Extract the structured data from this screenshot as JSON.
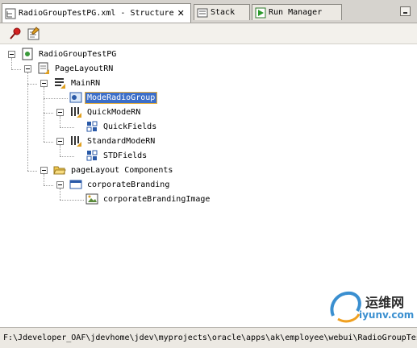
{
  "tabs": [
    {
      "label": "RadioGroupTestPG.xml - Structure",
      "icon": "structure-icon",
      "active": true
    },
    {
      "label": "Stack",
      "icon": "stack-icon",
      "active": false
    },
    {
      "label": "Run Manager",
      "icon": "run-manager-icon",
      "active": false
    }
  ],
  "toolbar": {
    "pin_icon": "pin-icon",
    "properties_icon": "properties-icon"
  },
  "tree": {
    "root": "RadioGroupTestPG",
    "page_layout": "PageLayoutRN",
    "main_rn": "MainRN",
    "mode_radio_group": "ModeRadioGroup",
    "quick_mode_rn": "QuickModeRN",
    "quick_fields": "QuickFields",
    "standard_mode_rn": "StandardModeRN",
    "std_fields": "STDFields",
    "page_layout_components": "pageLayout Components",
    "corporate_branding": "corporateBranding",
    "corporate_branding_image": "corporateBrandingImage"
  },
  "status": {
    "path": "F:\\Jdeveloper_OAF\\jdevhome\\jdev\\myprojects\\oracle\\apps\\ak\\employee\\webui\\RadioGroupTestPG.xml"
  },
  "watermark": {
    "line1": "运维网",
    "line2": "iyunv.com"
  }
}
